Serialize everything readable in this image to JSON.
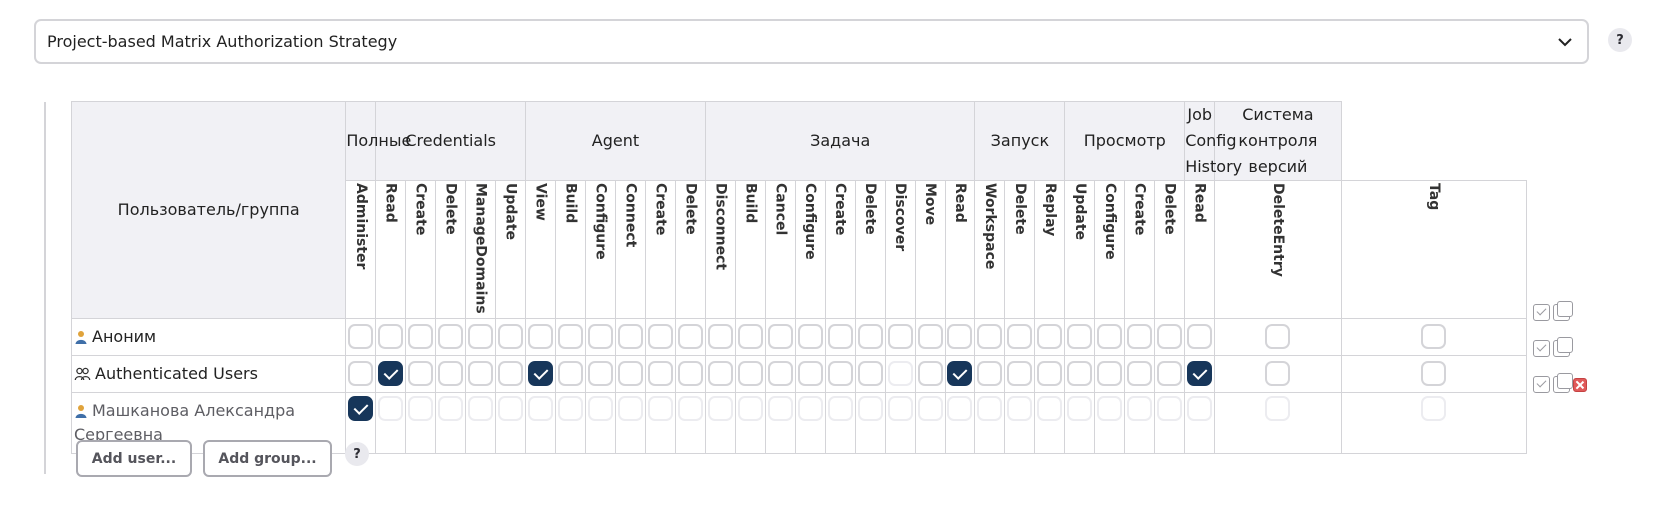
{
  "strategy": {
    "selected": "Project-based Matrix Authorization Strategy",
    "help": "?"
  },
  "matrix": {
    "corner_label": "Пользователь/группа",
    "groups": [
      {
        "label": "Полные",
        "span": 1
      },
      {
        "label": "Credentials",
        "span": 5
      },
      {
        "label": "Agent",
        "span": 6
      },
      {
        "label": "Задача",
        "span": 9
      },
      {
        "label": "Запуск",
        "span": 3
      },
      {
        "label": "Просмотр",
        "span": 4
      },
      {
        "label": "Job Config History",
        "span": 1
      },
      {
        "label": "Система контроля версий",
        "span": 1
      }
    ],
    "permissions": [
      "Administer",
      "Read",
      "Create",
      "Delete",
      "ManageDomains",
      "Update",
      "View",
      "Build",
      "Configure",
      "Connect",
      "Create",
      "Delete",
      "Disconnect",
      "Build",
      "Cancel",
      "Configure",
      "Create",
      "Delete",
      "Discover",
      "Move",
      "Read",
      "Workspace",
      "Delete",
      "Replay",
      "Update",
      "Configure",
      "Create",
      "Delete",
      "Read",
      "DeleteEntry",
      "Tag"
    ],
    "rows": [
      {
        "name": "Аноним",
        "icon": "person-icon",
        "checked": [],
        "disabled": []
      },
      {
        "name": "Authenticated Users",
        "icon": "group-icon",
        "checked": [
          1,
          6,
          20,
          28
        ],
        "disabled": [
          18
        ]
      },
      {
        "name": "Машканова Александра Сергеевна",
        "icon": "person-icon",
        "checked": [
          0
        ],
        "disabled": "all-except-checked"
      }
    ]
  },
  "buttons": {
    "add_user": "Add user...",
    "add_group": "Add group...",
    "help": "?"
  },
  "colors": {
    "checked": "#17365a",
    "border": "#d4d4d8",
    "header_bg": "#f1f1f5",
    "delete": "#e05a5a"
  }
}
